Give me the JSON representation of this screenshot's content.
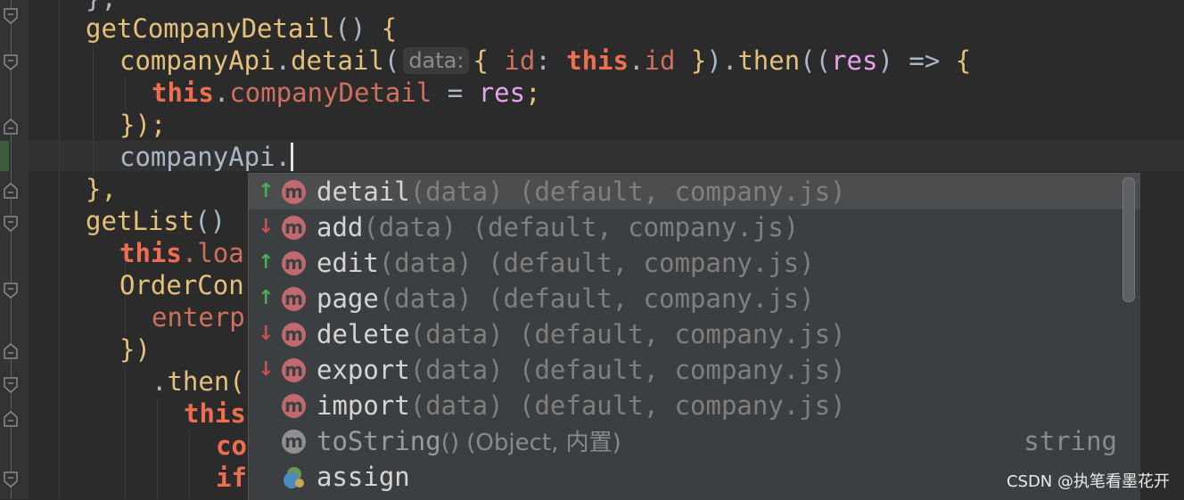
{
  "editor": {
    "lines": [
      {
        "tokens": [
          {
            "t": "},",
            "c": "pn"
          }
        ]
      },
      {
        "tokens": [
          {
            "t": "getCompanyDetail",
            "c": "fn"
          },
          {
            "t": "() ",
            "c": "pn"
          },
          {
            "t": "{",
            "c": "fn"
          }
        ]
      },
      {
        "tokens": [
          {
            "t": "companyApi",
            "c": "fn"
          },
          {
            "t": ".",
            "c": "pn"
          },
          {
            "t": "detail",
            "c": "fn"
          },
          {
            "t": "(",
            "c": "pn"
          },
          {
            "hint": "data:"
          },
          {
            "t": "{ ",
            "c": "fn"
          },
          {
            "t": "id",
            "c": "prop"
          },
          {
            "t": ": ",
            "c": "pn"
          },
          {
            "t": "this",
            "c": "kw"
          },
          {
            "t": ".",
            "c": "pn"
          },
          {
            "t": "id",
            "c": "prop"
          },
          {
            "t": " }",
            "c": "fn"
          },
          {
            "t": ").",
            "c": "pn"
          },
          {
            "t": "then",
            "c": "fn"
          },
          {
            "t": "((",
            "c": "pn"
          },
          {
            "t": "res",
            "c": "param"
          },
          {
            "t": ") => ",
            "c": "pn"
          },
          {
            "t": "{",
            "c": "fn"
          }
        ]
      },
      {
        "tokens": [
          {
            "t": "this",
            "c": "kw"
          },
          {
            "t": ".",
            "c": "pn"
          },
          {
            "t": "companyDetail",
            "c": "prop"
          },
          {
            "t": " = ",
            "c": "pn"
          },
          {
            "t": "res",
            "c": "param"
          },
          {
            "t": ";",
            "c": "fn"
          }
        ]
      },
      {
        "tokens": [
          {
            "t": "}",
            "c": "fn"
          },
          {
            "t": ");",
            "c": "fn"
          }
        ]
      },
      {
        "tokens": [
          {
            "t": "companyApi.",
            "c": "pn"
          },
          {
            "cursor": true
          }
        ]
      },
      {
        "tokens": [
          {
            "t": "},",
            "c": "fn"
          }
        ]
      },
      {
        "tokens": [
          {
            "t": "getList",
            "c": "fn"
          },
          {
            "t": "()",
            "c": "pn"
          }
        ]
      },
      {
        "tokens": [
          {
            "t": "this",
            "c": "kw"
          },
          {
            "t": ".loa",
            "c": "prop"
          }
        ]
      },
      {
        "tokens": [
          {
            "t": "OrderCon",
            "c": "fn"
          }
        ]
      },
      {
        "tokens": [
          {
            "t": "enterp",
            "c": "prop"
          }
        ]
      },
      {
        "tokens": [
          {
            "t": "})",
            "c": "fn"
          }
        ]
      },
      {
        "tokens": [
          {
            "t": ".",
            "c": "pn"
          },
          {
            "t": "then(",
            "c": "fn"
          }
        ]
      },
      {
        "tokens": [
          {
            "t": "this",
            "c": "kw"
          }
        ]
      },
      {
        "tokens": [
          {
            "t": "co",
            "c": "kw"
          }
        ]
      },
      {
        "tokens": [
          {
            "t": "if",
            "c": "kw"
          }
        ]
      }
    ]
  },
  "completion": {
    "items": [
      {
        "arrow": "up",
        "icon": "m",
        "name": "detail",
        "sig": "(data)",
        "info": " (default, company.js)",
        "selected": true
      },
      {
        "arrow": "down",
        "icon": "m",
        "name": "add",
        "sig": "(data)",
        "info": " (default, company.js)"
      },
      {
        "arrow": "up",
        "icon": "m",
        "name": "edit",
        "sig": "(data)",
        "info": " (default, company.js)"
      },
      {
        "arrow": "up",
        "icon": "m",
        "name": "page",
        "sig": "(data)",
        "info": " (default, company.js)"
      },
      {
        "arrow": "down",
        "icon": "m",
        "name": "delete",
        "sig": "(data)",
        "info": " (default, company.js)"
      },
      {
        "arrow": "down",
        "icon": "m",
        "name": "export",
        "sig": "(data)",
        "info": " (default, company.js)"
      },
      {
        "arrow": "",
        "icon": "m",
        "name": "import",
        "sig": "(data)",
        "info": " (default, company.js)"
      },
      {
        "arrow": "",
        "icon": "m-gray",
        "name": "toString",
        "sig": "()",
        "info": " (Object, 内置)",
        "type": "string",
        "dim": true
      },
      {
        "arrow": "",
        "icon": "property",
        "name": "assign",
        "sig": "",
        "info": ""
      }
    ]
  },
  "watermark": "CSDN @执笔看墨花开",
  "colors": {
    "background": "#2b2b2b",
    "popup": "#3c3f41",
    "keyword": "#ee6e4f",
    "function": "#e5c07b",
    "method_icon": "#c0696e"
  }
}
